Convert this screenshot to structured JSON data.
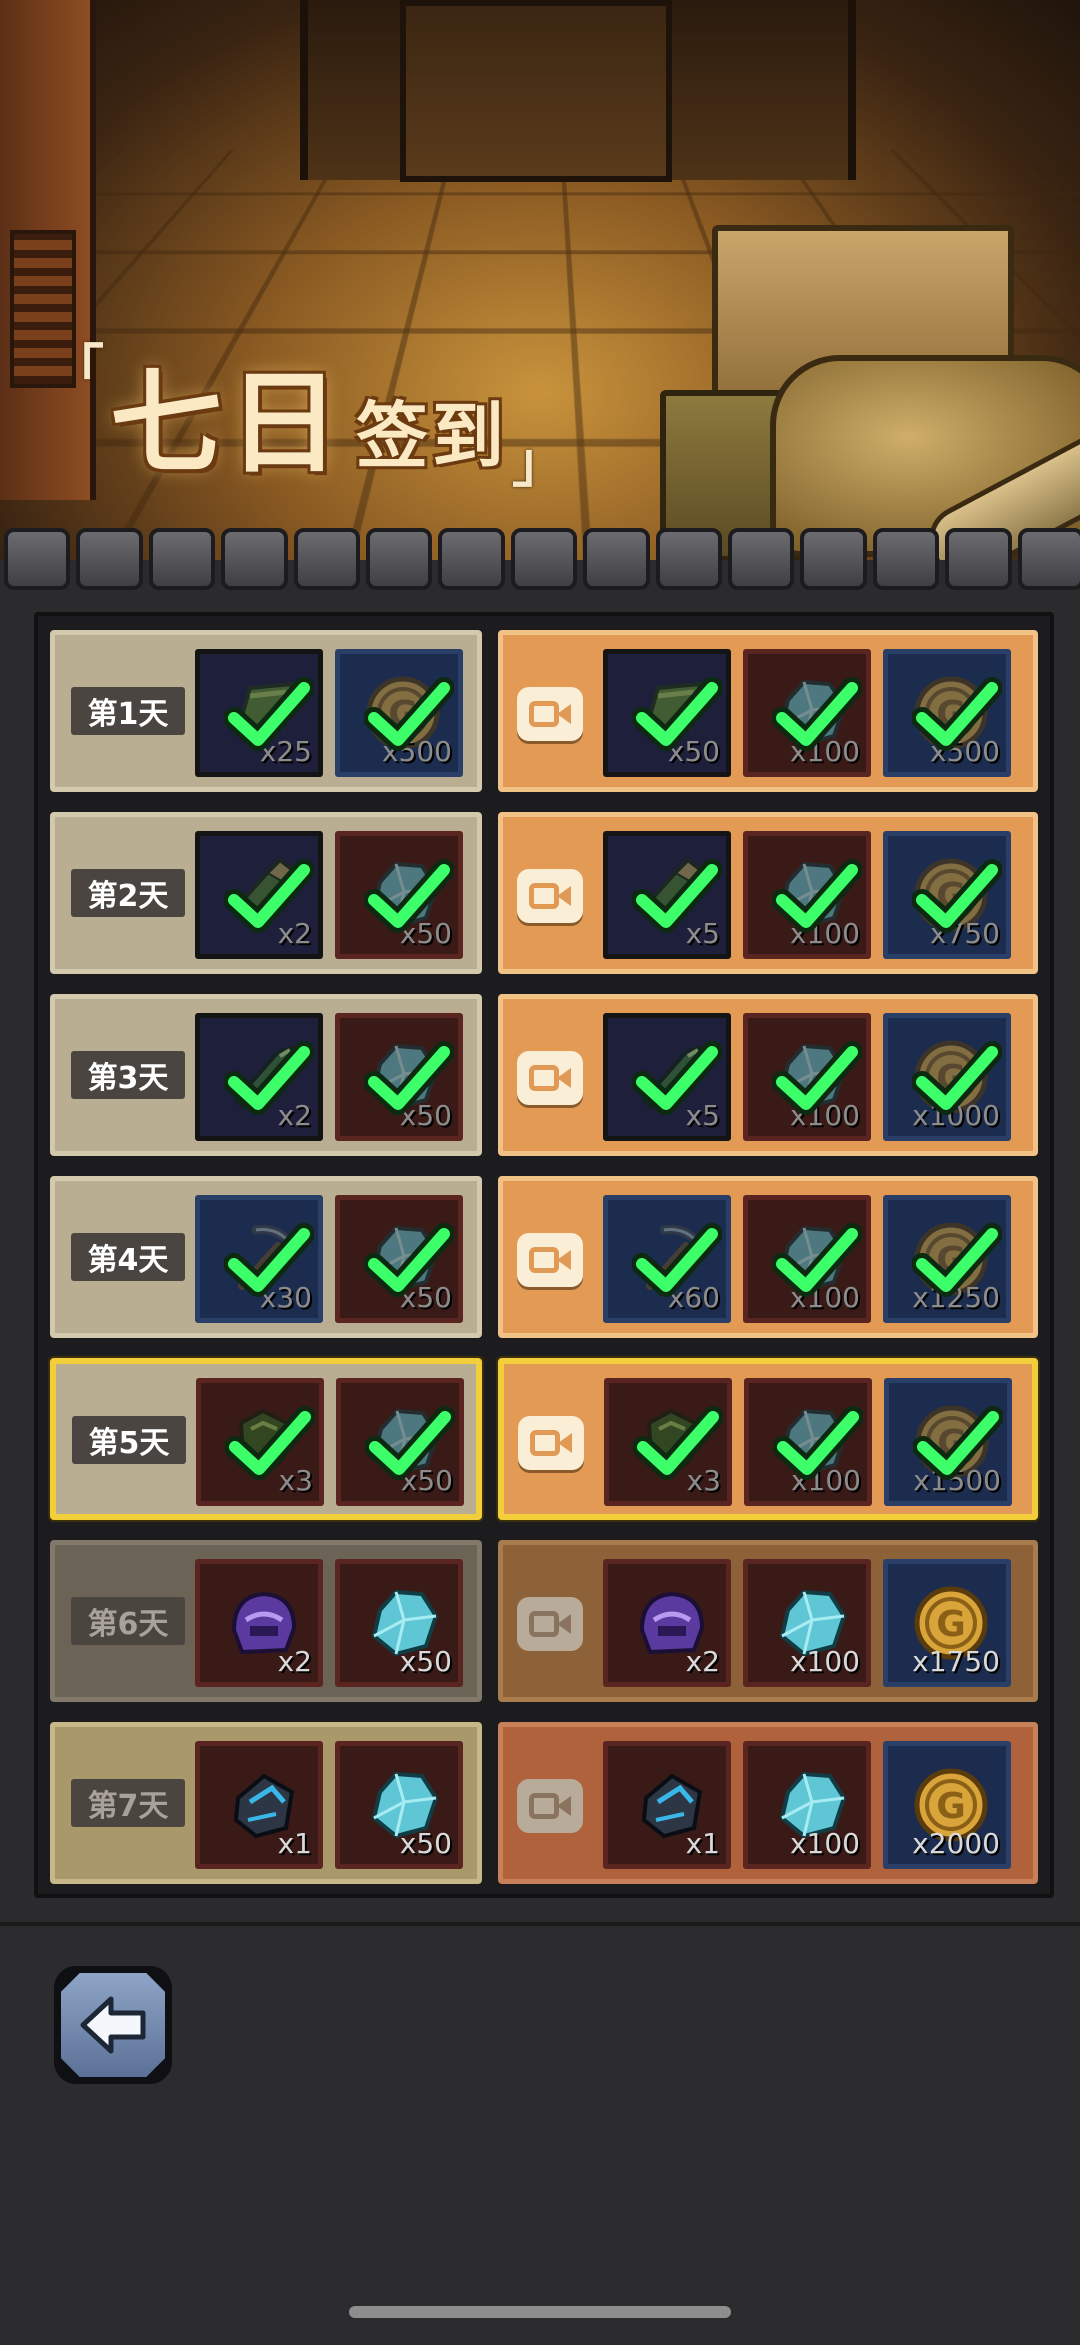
{
  "title": {
    "big": "七日",
    "small": "签到",
    "open": "「",
    "close": "」"
  },
  "colors": {
    "free_card": "#b9ae92",
    "video_card": "#e39a55",
    "highlight_border": "#f2cf3a",
    "check": "#3dff6a"
  },
  "current_day": 5,
  "days": [
    {
      "label": "第1天",
      "state": "claimed",
      "free": [
        {
          "icon": "green-ticket-icon",
          "count": "x25",
          "bg": "dark"
        },
        {
          "icon": "gold-coin-icon",
          "count": "x500",
          "bg": "navy"
        }
      ],
      "video": [
        {
          "icon": "green-ticket-icon",
          "count": "x50",
          "bg": "dark"
        },
        {
          "icon": "teal-gem-icon",
          "count": "x100",
          "bg": "wine"
        },
        {
          "icon": "gold-coin-icon",
          "count": "x500",
          "bg": "navy"
        }
      ]
    },
    {
      "label": "第2天",
      "state": "claimed",
      "free": [
        {
          "icon": "green-scroll-icon",
          "count": "x2",
          "bg": "dark"
        },
        {
          "icon": "teal-gem-icon",
          "count": "x50",
          "bg": "wine"
        }
      ],
      "video": [
        {
          "icon": "green-scroll-icon",
          "count": "x5",
          "bg": "dark"
        },
        {
          "icon": "teal-gem-icon",
          "count": "x100",
          "bg": "wine"
        },
        {
          "icon": "gold-coin-icon",
          "count": "x750",
          "bg": "navy"
        }
      ]
    },
    {
      "label": "第3天",
      "state": "claimed",
      "free": [
        {
          "icon": "green-blade-icon",
          "count": "x2",
          "bg": "dark"
        },
        {
          "icon": "teal-gem-icon",
          "count": "x50",
          "bg": "wine"
        }
      ],
      "video": [
        {
          "icon": "green-blade-icon",
          "count": "x5",
          "bg": "dark"
        },
        {
          "icon": "teal-gem-icon",
          "count": "x100",
          "bg": "wine"
        },
        {
          "icon": "gold-coin-icon",
          "count": "x1000",
          "bg": "navy"
        }
      ]
    },
    {
      "label": "第4天",
      "state": "claimed",
      "free": [
        {
          "icon": "pickaxe-icon",
          "count": "x30",
          "bg": "navy"
        },
        {
          "icon": "teal-gem-icon",
          "count": "x50",
          "bg": "wine"
        }
      ],
      "video": [
        {
          "icon": "pickaxe-icon",
          "count": "x60",
          "bg": "navy"
        },
        {
          "icon": "teal-gem-icon",
          "count": "x100",
          "bg": "wine"
        },
        {
          "icon": "gold-coin-icon",
          "count": "x1250",
          "bg": "navy"
        }
      ]
    },
    {
      "label": "第5天",
      "state": "claimed-today",
      "free": [
        {
          "icon": "green-armor-icon",
          "count": "x3",
          "bg": "wine"
        },
        {
          "icon": "teal-gem-icon",
          "count": "x50",
          "bg": "wine"
        }
      ],
      "video": [
        {
          "icon": "green-armor-icon",
          "count": "x3",
          "bg": "wine"
        },
        {
          "icon": "teal-gem-icon",
          "count": "x100",
          "bg": "wine"
        },
        {
          "icon": "gold-coin-icon",
          "count": "x1500",
          "bg": "navy"
        }
      ]
    },
    {
      "label": "第6天",
      "state": "locked",
      "free": [
        {
          "icon": "purple-helmet-icon",
          "count": "x2",
          "bg": "wine"
        },
        {
          "icon": "teal-gem-icon",
          "count": "x50",
          "bg": "wine"
        }
      ],
      "video": [
        {
          "icon": "purple-helmet-icon",
          "count": "x2",
          "bg": "wine"
        },
        {
          "icon": "teal-gem-icon",
          "count": "x100",
          "bg": "wine"
        },
        {
          "icon": "gold-coin-icon",
          "count": "x1750",
          "bg": "navy"
        }
      ]
    },
    {
      "label": "第7天",
      "state": "locked",
      "free": [
        {
          "icon": "dark-gauntlet-icon",
          "count": "x1",
          "bg": "wine"
        },
        {
          "icon": "teal-gem-icon",
          "count": "x50",
          "bg": "wine"
        }
      ],
      "video": [
        {
          "icon": "dark-gauntlet-icon",
          "count": "x1",
          "bg": "wine"
        },
        {
          "icon": "teal-gem-icon",
          "count": "x100",
          "bg": "wine"
        },
        {
          "icon": "gold-coin-icon",
          "count": "x2000",
          "bg": "navy"
        }
      ]
    }
  ],
  "back_button": {
    "icon": "back-arrow-icon"
  }
}
